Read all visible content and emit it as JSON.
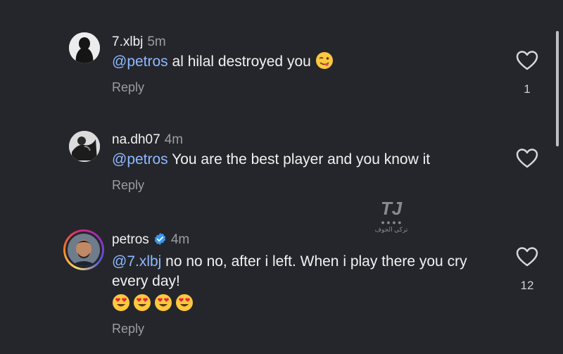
{
  "comments": [
    {
      "username": "7.xlbj",
      "time": "5m",
      "mention": "@petros",
      "text": " al hilal destroyed you ",
      "emoji": "winking-face-with-tongue",
      "reply_label": "Reply",
      "likes": "1"
    },
    {
      "username": "na.dh07",
      "time": "4m",
      "mention": "@petros",
      "text": " You are the best player and you know it",
      "reply_label": "Reply",
      "likes": ""
    },
    {
      "username": "petros",
      "verified": true,
      "time": "4m",
      "mention": "@7.xlbj",
      "text": " no no no, after i left. When i play there you cry every day!",
      "emojis": [
        "heart-eyes",
        "heart-eyes",
        "heart-eyes",
        "heart-eyes"
      ],
      "reply_label": "Reply",
      "likes": "12"
    }
  ],
  "watermark": {
    "logo": "TJ",
    "caption": "تركي الجوف"
  },
  "colors": {
    "background": "#24262b",
    "mention": "#8fb9ff",
    "muted": "#9a9da3",
    "verified": "#3897f0"
  }
}
